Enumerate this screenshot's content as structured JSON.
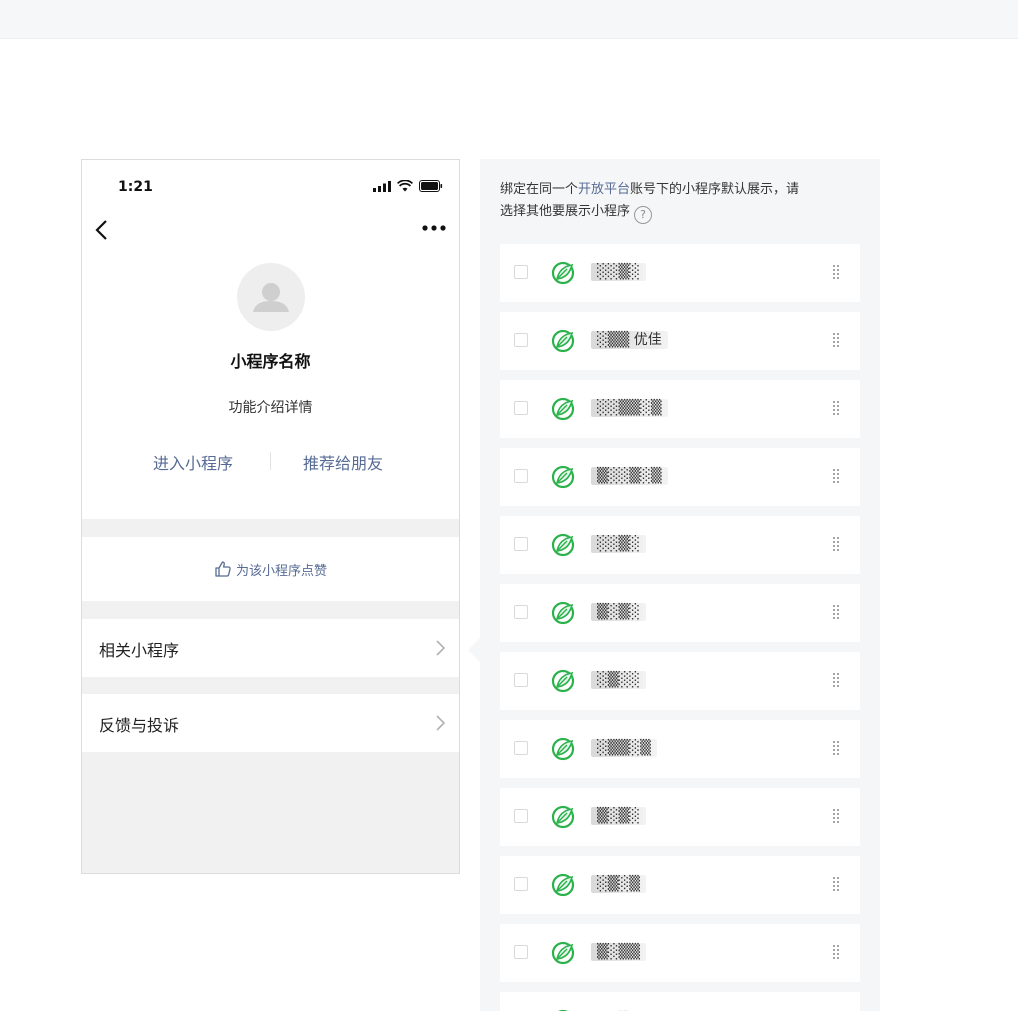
{
  "phone": {
    "status_time": "1:21",
    "app_name": "小程序名称",
    "app_desc": "功能介绍详情",
    "enter_label": "进入小程序",
    "share_label": "推荐给朋友",
    "like_label": "为该小程序点赞",
    "related_label": "相关小程序",
    "feedback_label": "反馈与投诉"
  },
  "panel": {
    "notice_prefix": "绑定在同一个",
    "notice_accent": "开放平台",
    "notice_middle": "账号下的小程序默认展示，请",
    "notice_line2": "选择其他要展示小程序",
    "help_symbol": "?"
  },
  "list": {
    "items": [
      {
        "name": "░░▒░"
      },
      {
        "name": "░▒▒ 优佳"
      },
      {
        "name": "░░▒▒░▒"
      },
      {
        "name": "▒░░▒░▒"
      },
      {
        "name": "░░▒░"
      },
      {
        "name": "▒░▒░"
      },
      {
        "name": "░▒░░"
      },
      {
        "name": "░▒▒░▒"
      },
      {
        "name": "▒░▒░"
      },
      {
        "name": "░▒░▒"
      },
      {
        "name": "▒░▒▒"
      },
      {
        "name": "░░▒"
      }
    ]
  },
  "colors": {
    "link_blue": "#576b95",
    "icon_green": "#2bb24c",
    "panel_bg": "#f5f6f7"
  },
  "icons": [
    "signal-icon",
    "wifi-icon",
    "battery-icon",
    "back-icon",
    "more-icon",
    "avatar-icon",
    "thumb-up-icon",
    "chevron-right-icon",
    "help-icon",
    "app-leaf-icon",
    "drag-handle-icon"
  ]
}
